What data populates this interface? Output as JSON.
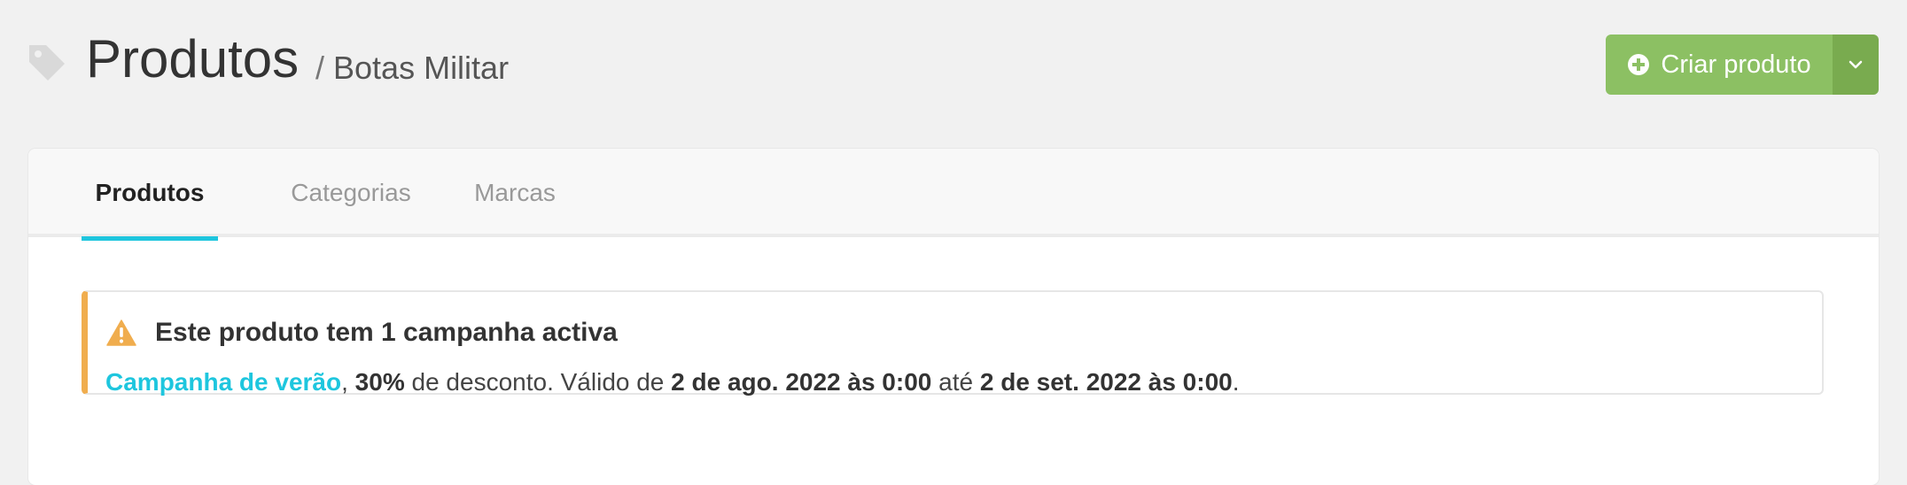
{
  "header": {
    "title": "Produtos",
    "breadcrumb_separator": "/",
    "breadcrumb_current": "Botas Militar",
    "title_icon": "tag-icon",
    "create_button": {
      "label": "Criar produto",
      "icon": "plus-circle-icon",
      "dropdown_icon": "chevron-down-icon"
    }
  },
  "tabs": [
    {
      "label": "Produtos",
      "active": true
    },
    {
      "label": "Categorias",
      "active": false
    },
    {
      "label": "Marcas",
      "active": false
    }
  ],
  "alert": {
    "icon": "warning-icon",
    "title": "Este produto tem 1 campanha activa",
    "campaign_name": "Campanha de verão",
    "comma": ",",
    "discount": "30%",
    "discount_suffix": "de desconto. Válido de",
    "start_date": "2 de ago. 2022 às 0:00",
    "until": "até",
    "end_date": "2 de set. 2022 às 0:00",
    "period": "."
  },
  "colors": {
    "background": "#f1f1f1",
    "primary_button": "#8cc063",
    "primary_button_dropdown": "#79ab4f",
    "accent": "#1ec6de",
    "warning": "#f0ad4e"
  }
}
